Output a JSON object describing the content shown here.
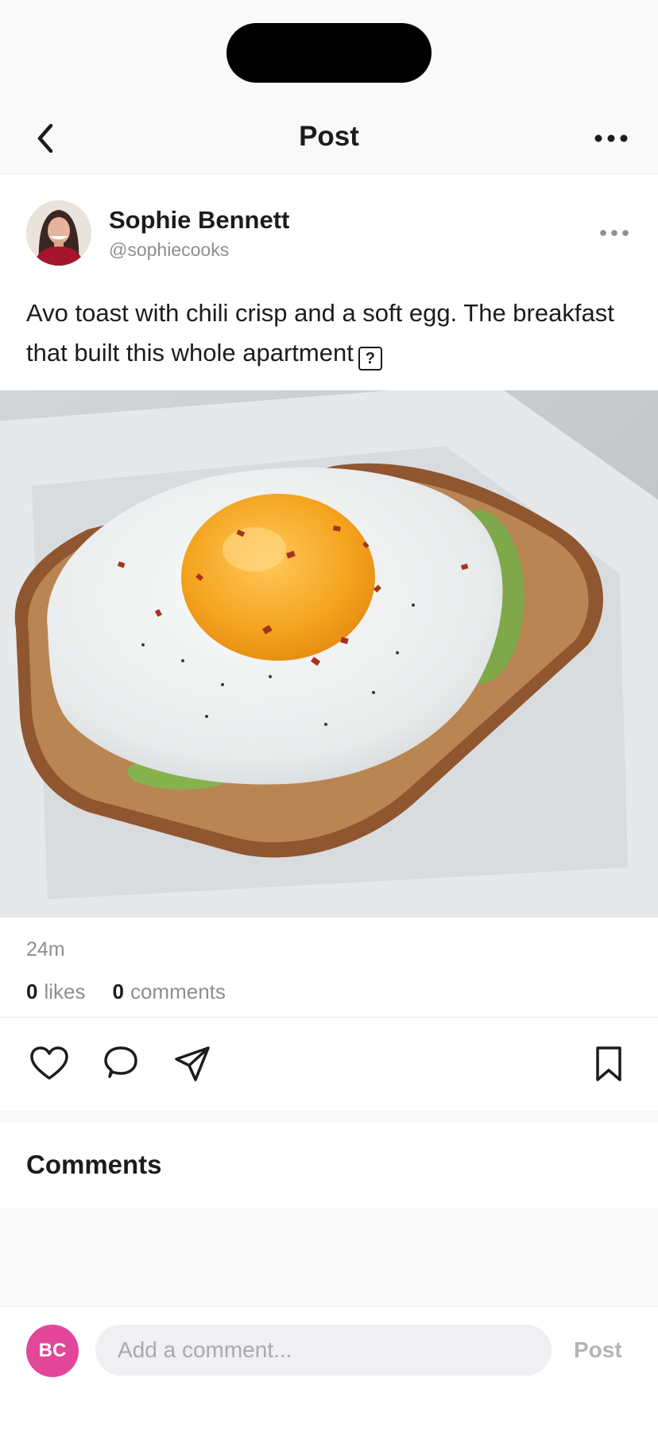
{
  "header": {
    "title": "Post"
  },
  "post": {
    "author_name": "Sophie Bennett",
    "author_handle": "@sophiecooks",
    "caption": "Avo toast with chili crisp and a soft egg. The breakfast that built this whole apartment",
    "caption_emoji": "?",
    "timestamp": "24m",
    "likes_count": "0",
    "likes_label": "likes",
    "comments_count": "0",
    "comments_label": "comments"
  },
  "actions": {
    "like_icon": "heart-icon",
    "comment_icon": "speech-bubble-icon",
    "share_icon": "paper-plane-icon",
    "save_icon": "bookmark-icon"
  },
  "comments": {
    "title": "Comments"
  },
  "composer": {
    "avatar_initials": "BC",
    "avatar_color": "#e2479a",
    "placeholder": "Add a comment...",
    "post_label": "Post"
  }
}
